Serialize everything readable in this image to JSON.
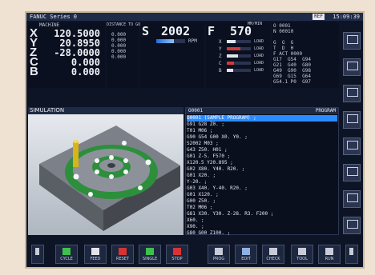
{
  "title_bar": {
    "title": "FANUC Series 0",
    "badge": "REF",
    "time": "15:09:39"
  },
  "axes": {
    "header_left": "MACHINE",
    "header_mid": "DISTANCE TO GO",
    "items": [
      {
        "letter": "X",
        "value": "120.5000"
      },
      {
        "letter": "Y",
        "value": "20.8950"
      },
      {
        "letter": "Z",
        "value": "-28.0000"
      },
      {
        "letter": "C",
        "value": "0.000"
      },
      {
        "letter": "B",
        "value": "0.000"
      }
    ]
  },
  "distance_col": [
    "0.000",
    "0.000",
    "0.000",
    "0.000",
    "0.000"
  ],
  "spindle": {
    "label": "S",
    "value": "2002",
    "unit": "RPM"
  },
  "feed": {
    "label": "F",
    "value": "570",
    "unit": "MM/MIN"
  },
  "load_meters": [
    {
      "label": "X",
      "level": 0.35,
      "unit": "LOAD"
    },
    {
      "label": "Y",
      "level": 0.55,
      "unit": "LOAD"
    },
    {
      "label": "Z",
      "level": 0.45,
      "unit": "LOAD"
    },
    {
      "label": "C",
      "level": 0.3,
      "unit": "LOAD"
    },
    {
      "label": "B",
      "level": 0.25,
      "unit": "LOAD"
    }
  ],
  "modal_panel": {
    "lines": [
      "O 0001",
      "N 00010",
      "",
      "G  G  G",
      "T  D  H",
      "F ACT 0000",
      "G17  G54  G94",
      "G21  G40  G80",
      "G49  G90  G98",
      "G69  G15  G64",
      "G54.1 P0  G97"
    ]
  },
  "sim_panel": {
    "title": "SIMULATION"
  },
  "program_panel": {
    "header": "O0001",
    "header_right": "PROGRAM",
    "lines": [
      "O0001 (SAMPLE PROGRAM) ;",
      "G91 G28 Z0. ;",
      "T01 M06 ;",
      "G90 G54 G00 X0. Y0. ;",
      "S2002 M03 ;",
      "G43 Z50. H01 ;",
      "G01 Z-5. F570 ;",
      "X120.5 Y20.895 ;",
      "G02 X80. Y40. R20. ;",
      "G01 X20. ;",
      "Y-20. ;",
      "G03 X40. Y-40. R20. ;",
      "G01 X120. ;",
      "G00 Z50. ;",
      "T02 M06 ;",
      "G81 X30. Y30. Z-28. R3. F200 ;",
      "X60. ;",
      "X90. ;",
      "G80 G00 Z100. ;",
      "M30 ;",
      "%",
      "",
      "",
      ""
    ]
  },
  "side_buttons": [
    {
      "icon": "tool-icon",
      "label": "TOOL"
    },
    {
      "icon": "ref-icon",
      "label": "REF"
    },
    {
      "icon": "mdi-icon",
      "label": "MDI"
    },
    {
      "icon": "jog-icon",
      "label": "JOG"
    },
    {
      "icon": "offset-icon",
      "label": "OFS"
    },
    {
      "icon": "prog-icon",
      "label": "PROG"
    },
    {
      "icon": "graph-icon",
      "label": "GRPH"
    },
    {
      "icon": "setting-icon",
      "label": "SET"
    }
  ],
  "soft_keys": [
    {
      "label": "",
      "icon": "menu-icon"
    },
    {
      "label": "CYCLE",
      "icon": "cycle-icon"
    },
    {
      "label": "FEED",
      "icon": "feed-icon"
    },
    {
      "label": "RESET",
      "icon": "reset-icon"
    },
    {
      "label": "SINGLE",
      "icon": "single-icon"
    },
    {
      "label": "STOP",
      "icon": "stop-icon"
    },
    {
      "label": "PROG",
      "icon": "prog2-icon"
    },
    {
      "label": "EDIT",
      "icon": "edit-icon"
    },
    {
      "label": "CHECK",
      "icon": "check-icon"
    },
    {
      "label": "TOOL",
      "icon": "tool2-icon"
    },
    {
      "label": "RUN",
      "icon": "run-icon"
    },
    {
      "label": "",
      "icon": "next-icon"
    }
  ],
  "colors": {
    "accent": "#2a7bd6",
    "panel_bg": "#0d1426",
    "highlight": "#2b8cff"
  }
}
